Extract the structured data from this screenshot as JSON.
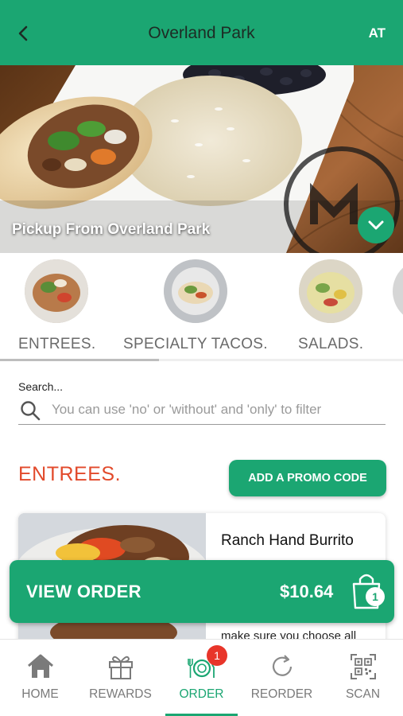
{
  "header": {
    "title": "Overland Park",
    "user_initials": "AT",
    "back_icon": "chevron-left-icon",
    "bar_color": "#1ba672"
  },
  "hero": {
    "caption": "Pickup From Overland Park",
    "expand_icon": "chevron-down-icon"
  },
  "categories": [
    {
      "label": "ENTREES."
    },
    {
      "label": "SPECIALTY TACOS."
    },
    {
      "label": "SALADS."
    }
  ],
  "search": {
    "label": "Search...",
    "placeholder": "You can use 'no' or 'without' and 'only' to filter",
    "value": "",
    "icon": "search-icon"
  },
  "section": {
    "title": "ENTREES.",
    "title_color": "#e24a2b",
    "promo_button": "ADD A PROMO CODE"
  },
  "menu_items": [
    {
      "name": "Ranch Hand Burrito",
      "description": "make sure you choose all"
    }
  ],
  "order": {
    "label": "VIEW ORDER",
    "total": "$10.64",
    "item_count": "1",
    "bag_icon": "shopping-bag-icon"
  },
  "tabs": [
    {
      "label": "HOME",
      "icon": "home-icon"
    },
    {
      "label": "REWARDS",
      "icon": "gift-icon"
    },
    {
      "label": "ORDER",
      "icon": "plate-cutlery-icon",
      "badge": "1",
      "active": true
    },
    {
      "label": "REORDER",
      "icon": "refresh-icon"
    },
    {
      "label": "SCAN",
      "icon": "qr-code-icon"
    }
  ],
  "colors": {
    "accent": "#1ba672",
    "badge": "#e8352a"
  }
}
